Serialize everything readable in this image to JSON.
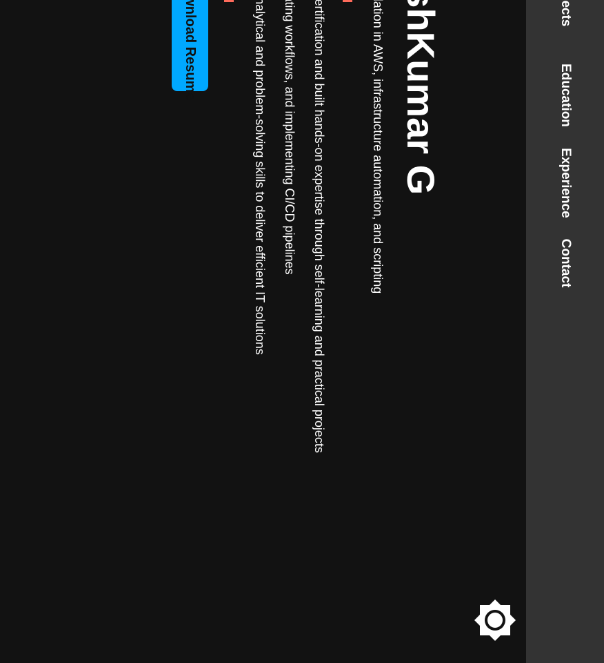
{
  "nav": {
    "items": [
      {
        "label": "Projects"
      },
      {
        "label": "Education"
      },
      {
        "label": "Experience"
      },
      {
        "label": "Contact"
      }
    ]
  },
  "hero": {
    "name": "aruneshKumar G",
    "lines": [
      "Strong foundation in AWS, infrastructure automation, and scripting",
      "AWS certification and built hands-on expertise through self-learning and practical projects",
      "automating workflows, and implementing CI/CD pipelines",
      "analytical and problem-solving skills to deliver efficient IT solutions"
    ],
    "resume_button": "Download Resume"
  },
  "theme_toggle": {
    "icon": "sun-icon"
  },
  "colors": {
    "background": "#121212",
    "navbar": "#333333",
    "accent_button": "#00a8ff",
    "accent_mark": "#ff6b5b",
    "text": "#ffffff"
  }
}
